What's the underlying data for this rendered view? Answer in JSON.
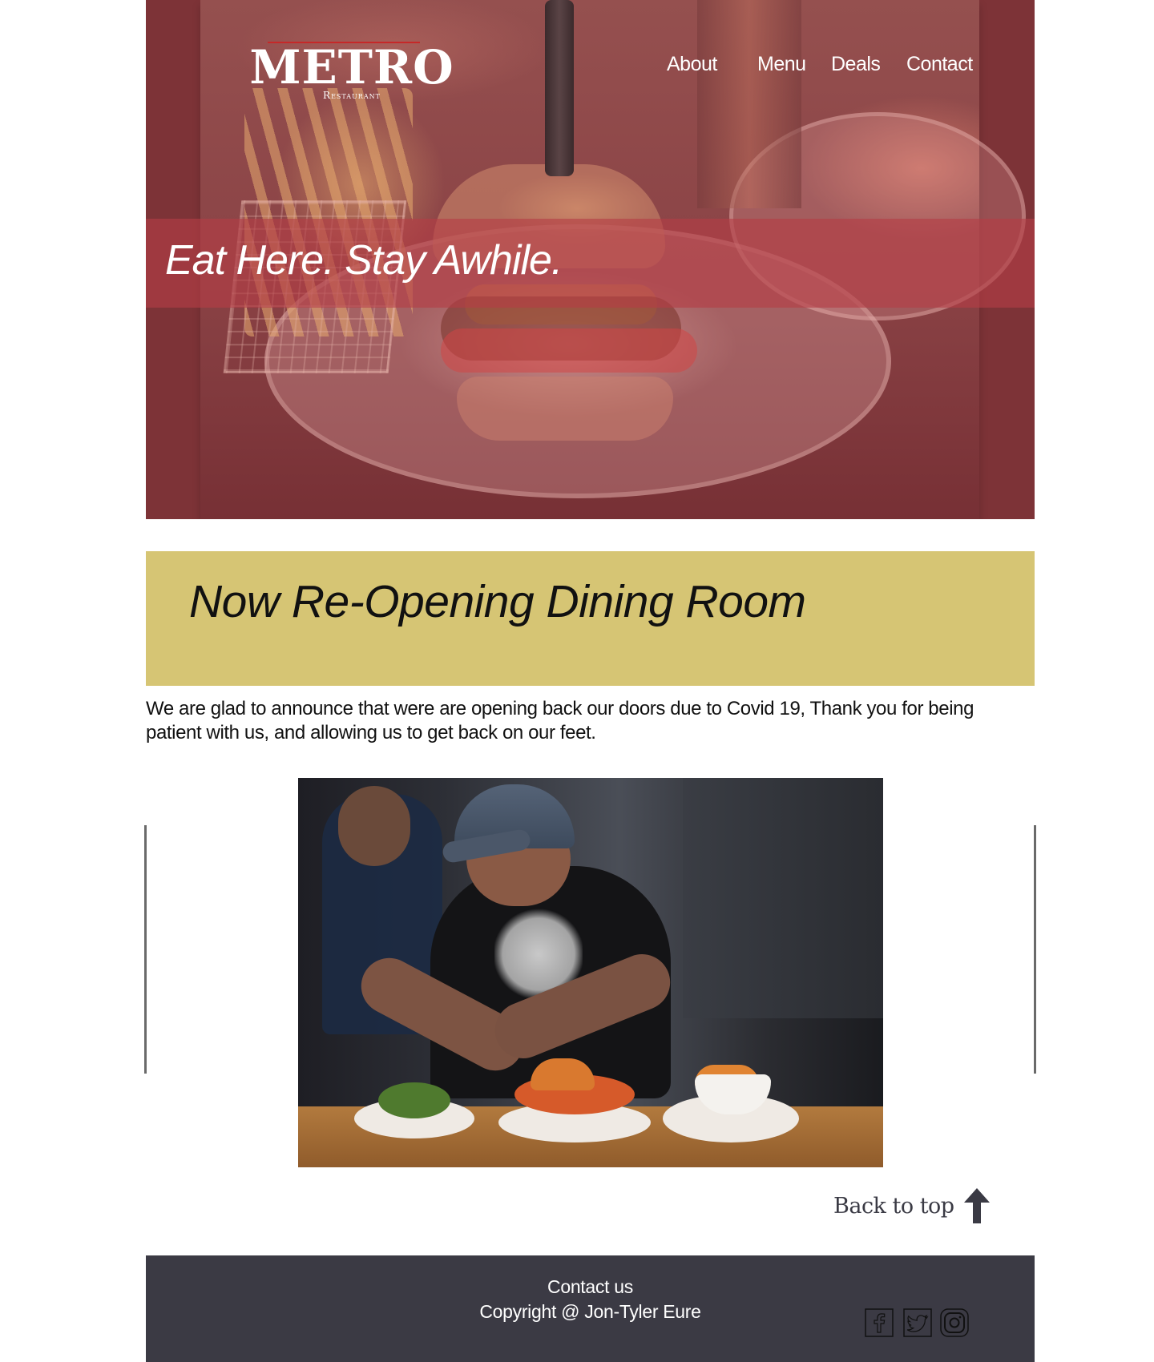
{
  "header": {
    "logo": {
      "title": "METRO",
      "subtitle": "Restaurant"
    },
    "nav": [
      {
        "label": "About"
      },
      {
        "label": "Menu"
      },
      {
        "label": "Deals"
      },
      {
        "label": "Contact"
      }
    ],
    "tagline": "Eat Here. Stay Awhile."
  },
  "announcement": {
    "title": "Now Re-Opening Dining Room",
    "text": "We are glad to announce that were are opening back our doors due to Covid 19, Thank you for being patient with us, and allowing us to get back on our feet."
  },
  "back_to_top": {
    "label": "Back to top",
    "icon": "up-arrow-icon"
  },
  "footer": {
    "contact": "Contact us",
    "copyright": "Copyright @ Jon-Tyler Eure",
    "social": [
      {
        "icon": "facebook-icon"
      },
      {
        "icon": "twitter-icon"
      },
      {
        "icon": "instagram-icon"
      }
    ]
  },
  "colors": {
    "hero_overlay": "#7d3337",
    "hero_band": "#b53e46",
    "announcement_bg": "#d6c574",
    "footer_bg": "#3b3a44",
    "text_dark": "#111111"
  }
}
